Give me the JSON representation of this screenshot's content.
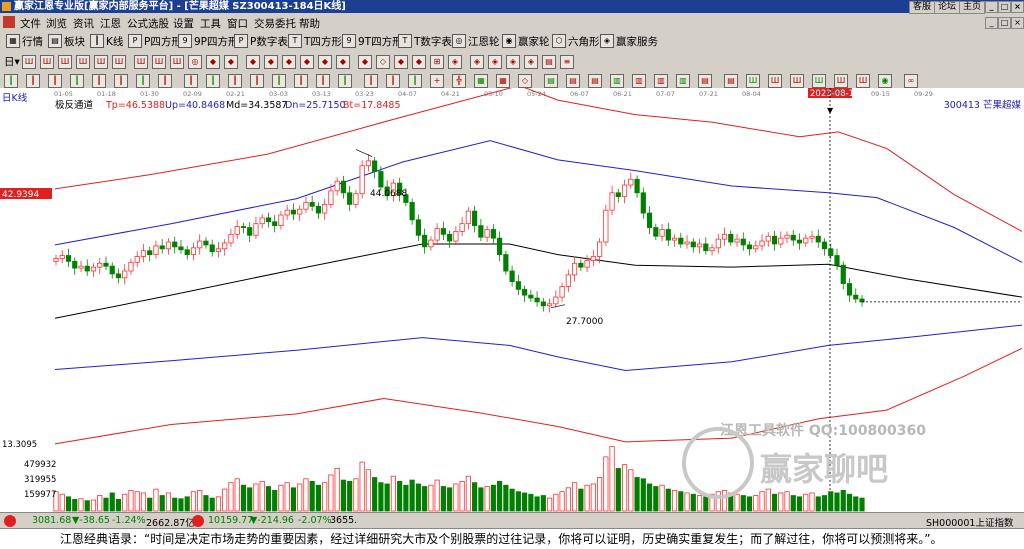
{
  "titlebar": {
    "title": "赢家江恩专业版[赢家内部服务平台] - [芒果超媒  SZ300413-184日K线]",
    "buttons": [
      "客服",
      "论坛",
      "主页"
    ],
    "window_controls": [
      "_",
      "□",
      "×"
    ]
  },
  "menubar": {
    "items": [
      "文件",
      "浏览",
      "资讯",
      "江恩",
      "公式选股",
      "设置",
      "工具",
      "窗口",
      "交易委托",
      "帮助"
    ],
    "right_controls": [
      "_",
      "□",
      "×"
    ]
  },
  "toolbar1": {
    "items": [
      {
        "icon": "grid-icon",
        "label": "行情"
      },
      {
        "icon": "block-icon",
        "label": "板块"
      },
      {
        "icon": "kline-icon",
        "label": "K线"
      },
      {
        "icon": "p-icon",
        "label": "P四方形"
      },
      {
        "icon": "9p-icon",
        "label": "9P四方形"
      },
      {
        "icon": "p-table-icon",
        "label": "P数字表"
      },
      {
        "icon": "t-icon",
        "label": "T四方形"
      },
      {
        "icon": "9t-icon",
        "label": "9T四方形"
      },
      {
        "icon": "t-table-icon",
        "label": "T数字表"
      },
      {
        "icon": "gann-wheel-icon",
        "label": "江恩轮"
      },
      {
        "icon": "winner-wheel-icon",
        "label": "赢家轮"
      },
      {
        "icon": "hexagon-icon",
        "label": "六角形"
      },
      {
        "icon": "service-icon",
        "label": "赢家服务"
      }
    ]
  },
  "infobar": {
    "period": "日K线",
    "indicator": "极反通道",
    "tp": "Tp=46.5388",
    "up": "Up=40.8468",
    "md": "Md=34.3587",
    "dn": "Dn=25.7150",
    "bt": "Bt=17.8485",
    "stock": "300413  芒果超媒"
  },
  "colors": {
    "up_candle": "#ff3030",
    "down_candle": "#008000",
    "red_band": "#e02020",
    "blue_band": "#2020d0",
    "mid_line": "#000000",
    "title_bg": "#1c3f94"
  },
  "chart_data": {
    "type": "candlestick",
    "x_ticks": [
      "01-05",
      "01-18",
      "01-30",
      "02-09",
      "02-21",
      "03-03",
      "03-13",
      "03-23",
      "04-07",
      "04-21",
      "05-10",
      "05-24",
      "06-07",
      "06-21",
      "07-07",
      "07-21",
      "08-04",
      "2023-08-15",
      "09-01",
      "09-15",
      "09-29"
    ],
    "cursor_date": "2023-08-15",
    "price_label": "42.9394",
    "annotations": [
      {
        "text": "44.0688",
        "x_date": "04-07",
        "y": 44.07
      },
      {
        "text": "27.7000",
        "x_date": "05-24",
        "y": 27.7
      }
    ],
    "last_close": 28.3,
    "volume_axis": {
      "label_top": "13.3095",
      "ticks": [
        "479932",
        "319955",
        "159977"
      ]
    },
    "ylim": [
      14,
      49
    ],
    "vol_max": 520000,
    "series_labels": [
      "Tp",
      "Up",
      "Md",
      "Dn",
      "Bt"
    ],
    "bands": {
      "tp": [
        [
          0,
          40.0
        ],
        [
          0.1,
          41.5
        ],
        [
          0.22,
          43.6
        ],
        [
          0.35,
          47.2
        ],
        [
          0.48,
          50.7
        ],
        [
          0.52,
          49.2
        ],
        [
          0.6,
          47.7
        ],
        [
          0.68,
          46.9
        ],
        [
          0.77,
          45.4
        ],
        [
          0.81,
          45.9
        ],
        [
          0.86,
          44.2
        ],
        [
          0.93,
          39.4
        ],
        [
          1.0,
          35.6
        ]
      ],
      "up": [
        [
          0,
          34.2
        ],
        [
          0.12,
          36.4
        ],
        [
          0.25,
          39.0
        ],
        [
          0.36,
          42.8
        ],
        [
          0.45,
          45.0
        ],
        [
          0.52,
          43.0
        ],
        [
          0.6,
          41.9
        ],
        [
          0.7,
          40.3
        ],
        [
          0.8,
          39.6
        ],
        [
          0.85,
          39.1
        ],
        [
          0.93,
          36.0
        ],
        [
          1.0,
          32.4
        ]
      ],
      "md": [
        [
          0,
          26.6
        ],
        [
          0.12,
          29.0
        ],
        [
          0.25,
          31.7
        ],
        [
          0.38,
          34.3
        ],
        [
          0.47,
          34.3
        ],
        [
          0.52,
          33.2
        ],
        [
          0.6,
          32.1
        ],
        [
          0.7,
          31.9
        ],
        [
          0.8,
          32.2
        ],
        [
          0.88,
          30.7
        ],
        [
          1.0,
          28.8
        ]
      ],
      "dn": [
        [
          0,
          21.3
        ],
        [
          0.12,
          22.2
        ],
        [
          0.25,
          23.3
        ],
        [
          0.38,
          24.6
        ],
        [
          0.47,
          23.8
        ],
        [
          0.52,
          22.6
        ],
        [
          0.59,
          21.2
        ],
        [
          0.7,
          22.1
        ],
        [
          0.8,
          23.8
        ],
        [
          0.88,
          24.6
        ],
        [
          1.0,
          25.9
        ]
      ],
      "bt": [
        [
          0,
          13.6
        ],
        [
          0.12,
          15.6
        ],
        [
          0.25,
          16.7
        ],
        [
          0.34,
          18.3
        ],
        [
          0.44,
          16.8
        ],
        [
          0.52,
          15.4
        ],
        [
          0.59,
          13.8
        ],
        [
          0.7,
          14.2
        ],
        [
          0.79,
          16.2
        ],
        [
          0.86,
          17.1
        ],
        [
          0.94,
          20.6
        ],
        [
          1.0,
          23.5
        ]
      ]
    },
    "closes": [
      32.8,
      33.1,
      32.5,
      31.8,
      32.0,
      31.5,
      31.9,
      32.3,
      32.0,
      31.2,
      30.8,
      31.5,
      32.4,
      33.0,
      33.6,
      33.2,
      34.1,
      33.8,
      34.5,
      34.0,
      33.7,
      33.2,
      33.9,
      34.6,
      34.2,
      33.5,
      33.8,
      34.4,
      35.3,
      36.1,
      36.0,
      35.2,
      36.4,
      37.0,
      36.6,
      36.2,
      37.3,
      37.8,
      37.4,
      37.9,
      38.6,
      38.2,
      37.5,
      38.4,
      39.8,
      40.8,
      39.6,
      38.4,
      39.5,
      42.4,
      42.9,
      41.8,
      40.2,
      39.3,
      40.6,
      39.4,
      38.6,
      36.8,
      35.2,
      34.0,
      34.7,
      35.9,
      35.3,
      34.6,
      35.6,
      36.4,
      37.7,
      36.2,
      35.0,
      35.8,
      34.9,
      33.2,
      31.5,
      30.4,
      29.6,
      29.0,
      28.7,
      28.3,
      27.9,
      28.1,
      28.8,
      29.9,
      31.1,
      32.3,
      31.9,
      32.6,
      33.0,
      34.5,
      37.8,
      39.6,
      39.2,
      40.4,
      41.0,
      39.6,
      37.5,
      36.0,
      35.1,
      35.8,
      34.7,
      34.9,
      34.3,
      34.5,
      34.0,
      34.3,
      33.6,
      33.9,
      34.8,
      35.3,
      34.5,
      34.8,
      34.2,
      33.8,
      34.1,
      34.6,
      35.1,
      34.3,
      34.9,
      35.2,
      34.7,
      34.4,
      34.9,
      35.1,
      34.5,
      33.8,
      33.1,
      32.1,
      30.2,
      29.0,
      28.6,
      28.3
    ],
    "volumes": [
      150000,
      130000,
      110000,
      90000,
      95000,
      80000,
      85000,
      120000,
      100000,
      140000,
      90000,
      130000,
      160000,
      150000,
      140000,
      100000,
      170000,
      120000,
      140000,
      100000,
      95000,
      110000,
      150000,
      160000,
      120000,
      100000,
      110000,
      170000,
      220000,
      250000,
      200000,
      180000,
      210000,
      230000,
      190000,
      160000,
      200000,
      220000,
      180000,
      210000,
      250000,
      230000,
      200000,
      220000,
      280000,
      330000,
      240000,
      230000,
      250000,
      380000,
      320000,
      260000,
      220000,
      210000,
      270000,
      230000,
      200000,
      240000,
      210000,
      190000,
      200000,
      240000,
      190000,
      180000,
      210000,
      230000,
      270000,
      220000,
      180000,
      190000,
      200000,
      230000,
      200000,
      170000,
      150000,
      140000,
      130000,
      110000,
      120000,
      100000,
      130000,
      150000,
      180000,
      220000,
      170000,
      200000,
      210000,
      260000,
      420000,
      500000,
      330000,
      360000,
      320000,
      260000,
      250000,
      210000,
      190000,
      200000,
      170000,
      160000,
      150000,
      140000,
      130000,
      120000,
      110000,
      130000,
      150000,
      160000,
      140000,
      130000,
      120000,
      110000,
      120000,
      150000,
      170000,
      130000,
      140000,
      150000,
      120000,
      110000,
      130000,
      140000,
      110000,
      120000,
      150000,
      140000,
      160000,
      130000,
      110000,
      100000
    ]
  },
  "status": {
    "sh_index": "3081.68",
    "sh_change": "▼-38.65",
    "sh_pct": "-1.24%",
    "sh_amount": "2662.87亿",
    "sz_index": "10159.77",
    "sz_change": "▼-214.96",
    "sz_pct": "-2.07%",
    "sz_amount": "3655.",
    "right_label": "SH000001上证指数"
  },
  "watermark": {
    "line1": "江恩工具软件  QQ:100800360",
    "line2": "赢家聊吧"
  },
  "quote": {
    "text": "江恩经典语录：“时间是决定市场走势的重要因素，经过详细研究大市及个别股票的过往记录，你将可以证明，历史确实重复发生；而了解过往，你将可以预测将来。”。"
  }
}
